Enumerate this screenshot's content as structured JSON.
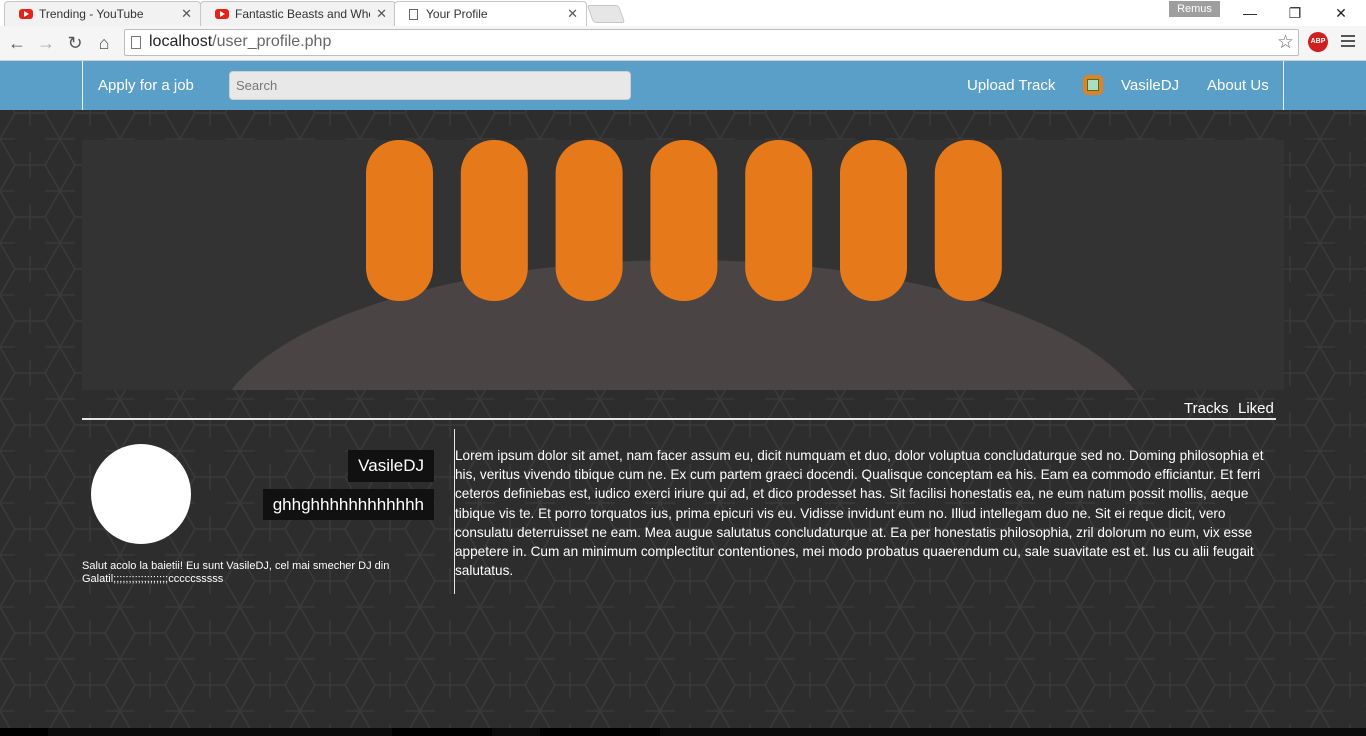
{
  "browser": {
    "tabs": [
      {
        "title": "Trending - YouTube",
        "icon": "youtube-icon",
        "active": false
      },
      {
        "title": "Fantastic Beasts and Whe",
        "icon": "youtube-icon",
        "active": false
      },
      {
        "title": "Your Profile",
        "icon": "document-icon",
        "active": true
      }
    ],
    "user_chip": "Remus",
    "url_host": "localhost",
    "url_path": "/user_profile.php",
    "abp_label": "ABP"
  },
  "nav": {
    "apply_label": "Apply for a job",
    "search_placeholder": "Search",
    "upload_label": "Upload Track",
    "username": "VasileDJ",
    "about_label": "About Us"
  },
  "banner": {
    "bar_color": "#e67a1a",
    "bar_count": 7,
    "mound_color": "#4a4444"
  },
  "subnav": {
    "tracks_label": "Tracks",
    "liked_label": "Liked"
  },
  "profile": {
    "name": "VasileDJ",
    "tagline": "ghhghhhhhhhhhhhh",
    "bio": "Salut acolo la baietii! Eu sunt VasileDJ, cel mai smecher DJ din Galatil;;;;;;;;;;;;;;;;;;cccccsssss",
    "description": "Lorem ipsum dolor sit amet, nam facer assum eu, dicit numquam et duo, dolor voluptua concludaturque sed no. Doming philosophia et his, veritus vivendo tibique cum ne. Ex cum partem graeci docendi. Qualisque conceptam ea his. Eam ea commodo efficiantur. Et ferri ceteros definiebas est, iudico exerci iriure qui ad, et dico prodesset has. Sit facilisi honestatis ea, ne eum natum possit mollis, aeque tibique vis te. Et porro torquatos ius, prima epicuri vis eu. Vidisse invidunt eum no. Illud intellegam duo ne. Sit ei reque dicit, vero consulatu deterruisset ne eam. Mea augue salutatus concludaturque at. Ea per honestatis philosophia, zril dolorum no eum, vix esse appetere in. Cum an minimum complectitur contentiones, mei modo probatus quaerendum cu, sale suavitate est et. Ius cu alii feugait salutatus."
  },
  "colors": {
    "nav_bg": "#5a9fc8",
    "page_bg": "#2d2d2d"
  }
}
